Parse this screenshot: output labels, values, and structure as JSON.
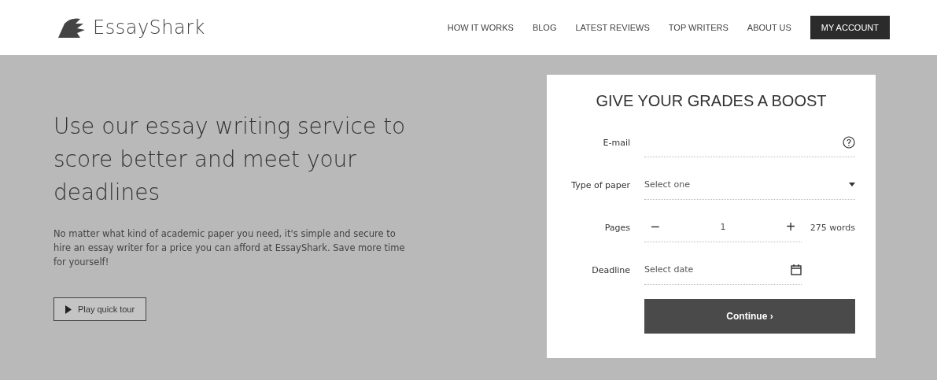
{
  "header": {
    "logo": "EssayShark",
    "nav": [
      {
        "label": "HOW IT WORKS"
      },
      {
        "label": "BLOG"
      },
      {
        "label": "LATEST REVIEWS"
      },
      {
        "label": "TOP WRITERS"
      },
      {
        "label": "ABOUT US"
      }
    ],
    "account_button": "MY ACCOUNT"
  },
  "hero": {
    "heading": "Use our essay writing service to score better and meet your deadlines",
    "text": "No matter what kind of academic paper you need, it's simple and secure to hire an essay writer for a price you can afford at EssayShark. Save more time for yourself!",
    "tour_button": "Play quick tour"
  },
  "form": {
    "title": "GIVE YOUR GRADES A BOOST",
    "email_label": "E-mail",
    "paper_label": "Type of paper",
    "paper_placeholder": "Select one",
    "pages_label": "Pages",
    "pages_minus": "−",
    "pages_value": "1",
    "pages_plus": "+",
    "words": "275 words",
    "deadline_label": "Deadline",
    "deadline_placeholder": "Select date",
    "submit": "Continue ›"
  }
}
